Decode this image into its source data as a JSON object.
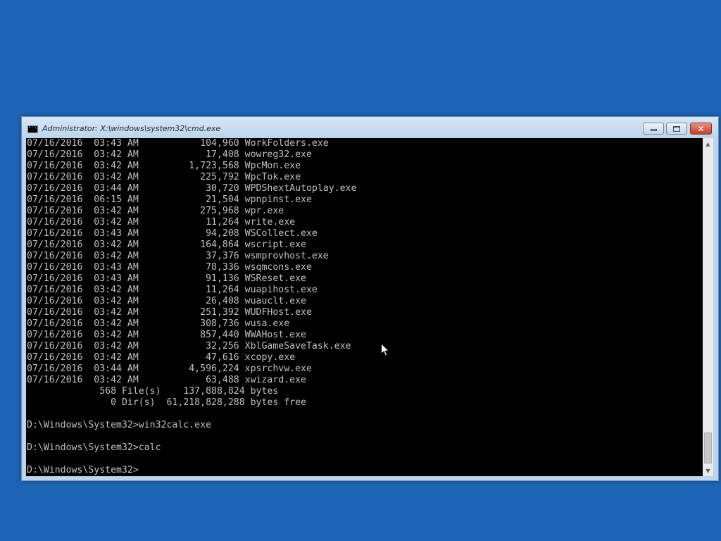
{
  "window": {
    "title": "Administrator: X:\\windows\\system32\\cmd.exe",
    "minimize_glyph": "minimize",
    "maximize_glyph": "restore",
    "close_glyph": "x"
  },
  "console": {
    "lines": [
      "07/16/2016  03:43 AM           104,960 WorkFolders.exe",
      "07/16/2016  03:42 AM            17,408 wowreg32.exe",
      "07/16/2016  03:42 AM         1,723,568 WpcMon.exe",
      "07/16/2016  03:42 AM           225,792 WpcTok.exe",
      "07/16/2016  03:44 AM            30,720 WPDShextAutoplay.exe",
      "07/16/2016  06:15 AM            21,504 wpnpinst.exe",
      "07/16/2016  03:42 AM           275,968 wpr.exe",
      "07/16/2016  03:42 AM            11,264 write.exe",
      "07/16/2016  03:43 AM            94,208 WSCollect.exe",
      "07/16/2016  03:42 AM           164,864 wscript.exe",
      "07/16/2016  03:42 AM            37,376 wsmprovhost.exe",
      "07/16/2016  03:43 AM            78,336 wsqmcons.exe",
      "07/16/2016  03:43 AM            91,136 WSReset.exe",
      "07/16/2016  03:42 AM            11,264 wuapihost.exe",
      "07/16/2016  03:42 AM            26,408 wuauclt.exe",
      "07/16/2016  03:42 AM           251,392 WUDFHost.exe",
      "07/16/2016  03:42 AM           308,736 wusa.exe",
      "07/16/2016  03:42 AM           857,440 WWAHost.exe",
      "07/16/2016  03:42 AM            32,256 XblGameSaveTask.exe",
      "07/16/2016  03:42 AM            47,616 xcopy.exe",
      "07/16/2016  03:44 AM         4,596,224 xpsrchvw.exe",
      "07/16/2016  03:42 AM            63,488 xwizard.exe",
      "             568 File(s)    137,888,824 bytes",
      "               0 Dir(s)  61,218,828,288 bytes free",
      "",
      "D:\\Windows\\System32>win32calc.exe",
      "",
      "D:\\Windows\\System32>calc",
      "",
      "D:\\Windows\\System32>"
    ]
  },
  "colors": {
    "desktop": "#1e64b4",
    "console_bg": "#000000",
    "console_fg": "#c0c0c0"
  }
}
